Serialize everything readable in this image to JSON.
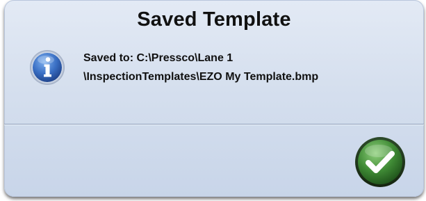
{
  "dialog": {
    "title": "Saved Template",
    "icon": "info-icon",
    "message_line_1": "Saved to: C:\\Pressco\\Lane 1",
    "message_line_2": "\\InspectionTemplates\\EZO My Template.bmp",
    "ok_button_icon": "checkmark-icon"
  },
  "colors": {
    "dialog_bg": "#d5dfee",
    "info_icon_blue": "#2f5fb0",
    "ok_button_green": "#3f8a35"
  }
}
